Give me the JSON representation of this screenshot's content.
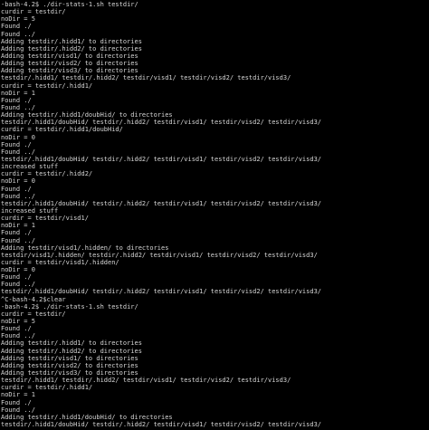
{
  "terminal": {
    "lines": [
      "-bash-4.2$ ./dir-stats-1.sh testdir/",
      "curdir = testdir/",
      "noDir = 5",
      "Found ./",
      "Found ../",
      "Adding testdir/.hidd1/ to directories",
      "Adding testdir/.hidd2/ to directories",
      "Adding testdir/visd1/ to directories",
      "Adding testdir/visd2/ to directories",
      "Adding testdir/visd3/ to directories",
      "testdir/.hidd1/ testdir/.hidd2/ testdir/visd1/ testdir/visd2/ testdir/visd3/",
      "curdir = testdir/.hidd1/",
      "noDir = 1",
      "Found ./",
      "Found ../",
      "Adding testdir/.hidd1/doubHid/ to directories",
      "testdir/.hidd1/doubHid/ testdir/.hidd2/ testdir/visd1/ testdir/visd2/ testdir/visd3/",
      "curdir = testdir/.hidd1/doubHid/",
      "noDir = 0",
      "Found ./",
      "Found ../",
      "testdir/.hidd1/doubHid/ testdir/.hidd2/ testdir/visd1/ testdir/visd2/ testdir/visd3/",
      "increased stuff",
      "curdir = testdir/.hidd2/",
      "noDir = 0",
      "Found ./",
      "Found ../",
      "testdir/.hidd1/doubHid/ testdir/.hidd2/ testdir/visd1/ testdir/visd2/ testdir/visd3/",
      "increased stuff",
      "curdir = testdir/visd1/",
      "noDir = 1",
      "Found ./",
      "Found ../",
      "Adding testdir/visd1/.hidden/ to directories",
      "testdir/visd1/.hidden/ testdir/.hidd2/ testdir/visd1/ testdir/visd2/ testdir/visd3/",
      "curdir = testdir/visd1/.hidden/",
      "noDir = 0",
      "Found ./",
      "Found ../",
      "testdir/.hidd1/doubHid/ testdir/.hidd2/ testdir/visd1/ testdir/visd2/ testdir/visd3/",
      "^C-bash-4.2$clear",
      "-bash-4.2$ ./dir-stats-1.sh testdir/",
      "curdir = testdir/",
      "noDir = 5",
      "Found ./",
      "Found ../",
      "Adding testdir/.hidd1/ to directories",
      "Adding testdir/.hidd2/ to directories",
      "Adding testdir/visd1/ to directories",
      "Adding testdir/visd2/ to directories",
      "Adding testdir/visd3/ to directories",
      "testdir/.hidd1/ testdir/.hidd2/ testdir/visd1/ testdir/visd2/ testdir/visd3/",
      "curdir = testdir/.hidd1/",
      "noDir = 1",
      "Found ./",
      "Found ../",
      "Adding testdir/.hidd1/doubHid/ to directories",
      "testdir/.hidd1/doubHid/ testdir/.hidd2/ testdir/visd1/ testdir/visd2/ testdir/visd3/"
    ]
  }
}
